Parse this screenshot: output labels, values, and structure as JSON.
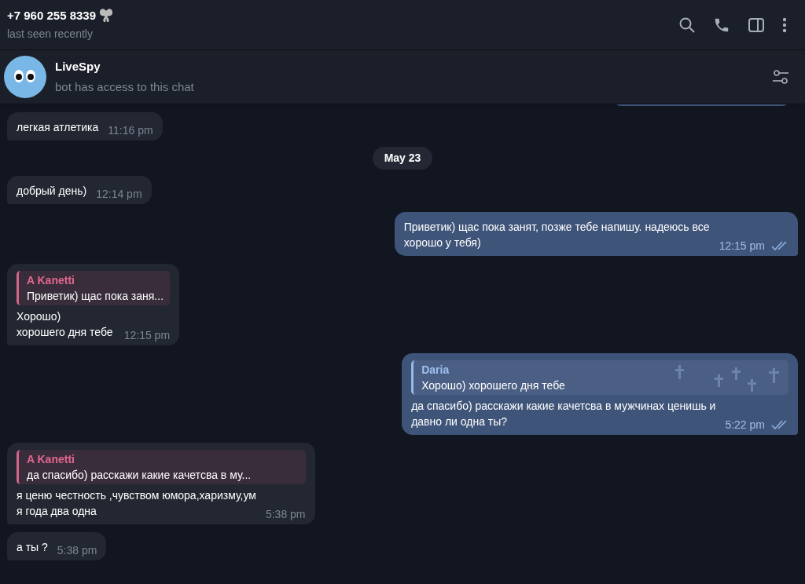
{
  "header": {
    "title": "+7 960 255 8339",
    "status": "last seen recently"
  },
  "pinned_bot": {
    "name": "LiveSpy",
    "subtitle": "bot has access to this chat"
  },
  "messages": [
    {
      "kind": "partial",
      "outgoing": true
    },
    {
      "kind": "message",
      "outgoing": false,
      "text": "легкая атлетика",
      "time": "11:16 pm"
    },
    {
      "kind": "date",
      "text": "May 23"
    },
    {
      "kind": "message",
      "outgoing": false,
      "text": "добрый день)",
      "time": "12:14 pm"
    },
    {
      "kind": "message",
      "outgoing": true,
      "text": "Приветик) щас пока занят, позже тебе напишу. надеюсь все\nхорошо у тебя)",
      "time": "12:15 pm",
      "read": true
    },
    {
      "kind": "message",
      "outgoing": false,
      "reply": {
        "name": "A Kanetti",
        "text": "Приветик) щас пока заня..."
      },
      "text": "Хорошо)\nхорошего дня тебе",
      "time": "12:15 pm"
    },
    {
      "kind": "message",
      "outgoing": true,
      "reply": {
        "name": "Daria",
        "text": "Хорошо)  хорошего дня тебе"
      },
      "text": "да спасибо) расскажи какие качетсва в мужчинах ценишь и\nдавно ли одна ты?",
      "time": "5:22 pm",
      "read": true
    },
    {
      "kind": "message",
      "outgoing": false,
      "reply": {
        "name": "A Kanetti",
        "text": "да спасибо) расскажи какие качетсва в му..."
      },
      "text": "я ценю честность ,чувством юмора,харизму,ум\nя года два одна",
      "time": "5:38 pm"
    },
    {
      "kind": "message",
      "outgoing": false,
      "text": "а ты ?",
      "time": "5:38 pm"
    }
  ]
}
